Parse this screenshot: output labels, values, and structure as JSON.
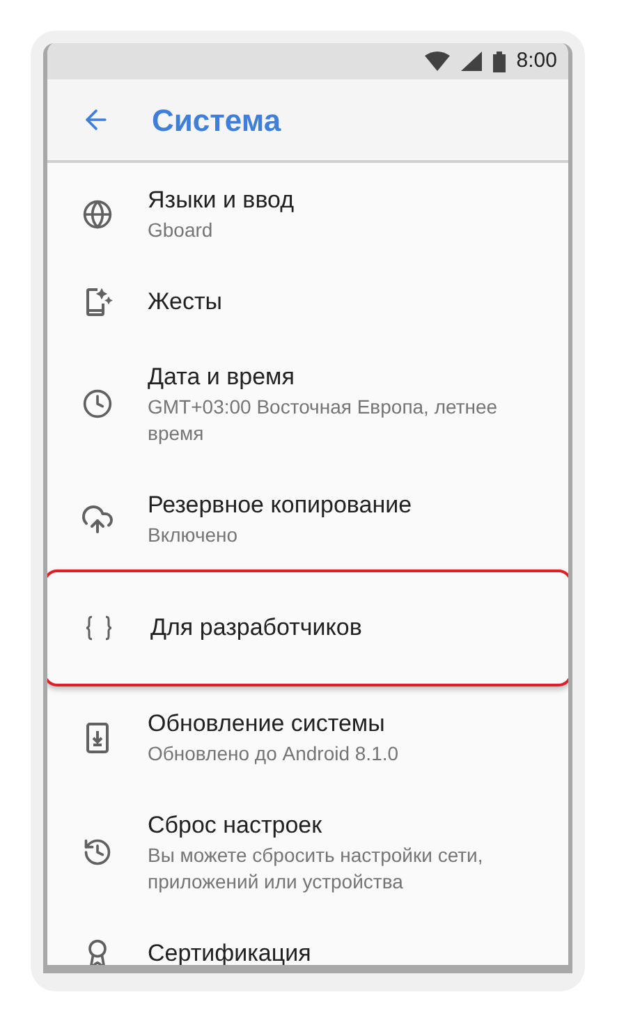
{
  "status_bar": {
    "time": "8:00"
  },
  "app_bar": {
    "title": "Система"
  },
  "items": [
    {
      "title": "Языки и ввод",
      "subtitle": "Gboard",
      "highlighted": false
    },
    {
      "title": "Жесты",
      "highlighted": false
    },
    {
      "title": "Дата и время",
      "subtitle": "GMT+03:00 Восточная Европа, летнее время",
      "highlighted": false
    },
    {
      "title": "Резервное копирование",
      "subtitle": "Включено",
      "highlighted": false
    },
    {
      "title": "Для разработчиков",
      "highlighted": true
    },
    {
      "title": "Обновление системы",
      "subtitle": "Обновлено до Android 8.1.0",
      "highlighted": false
    },
    {
      "title": "Сброс настроек",
      "subtitle": "Вы можете сбросить настройки сети, приложений или устройства",
      "highlighted": false
    },
    {
      "title": "Сертификация",
      "highlighted": false
    }
  ]
}
